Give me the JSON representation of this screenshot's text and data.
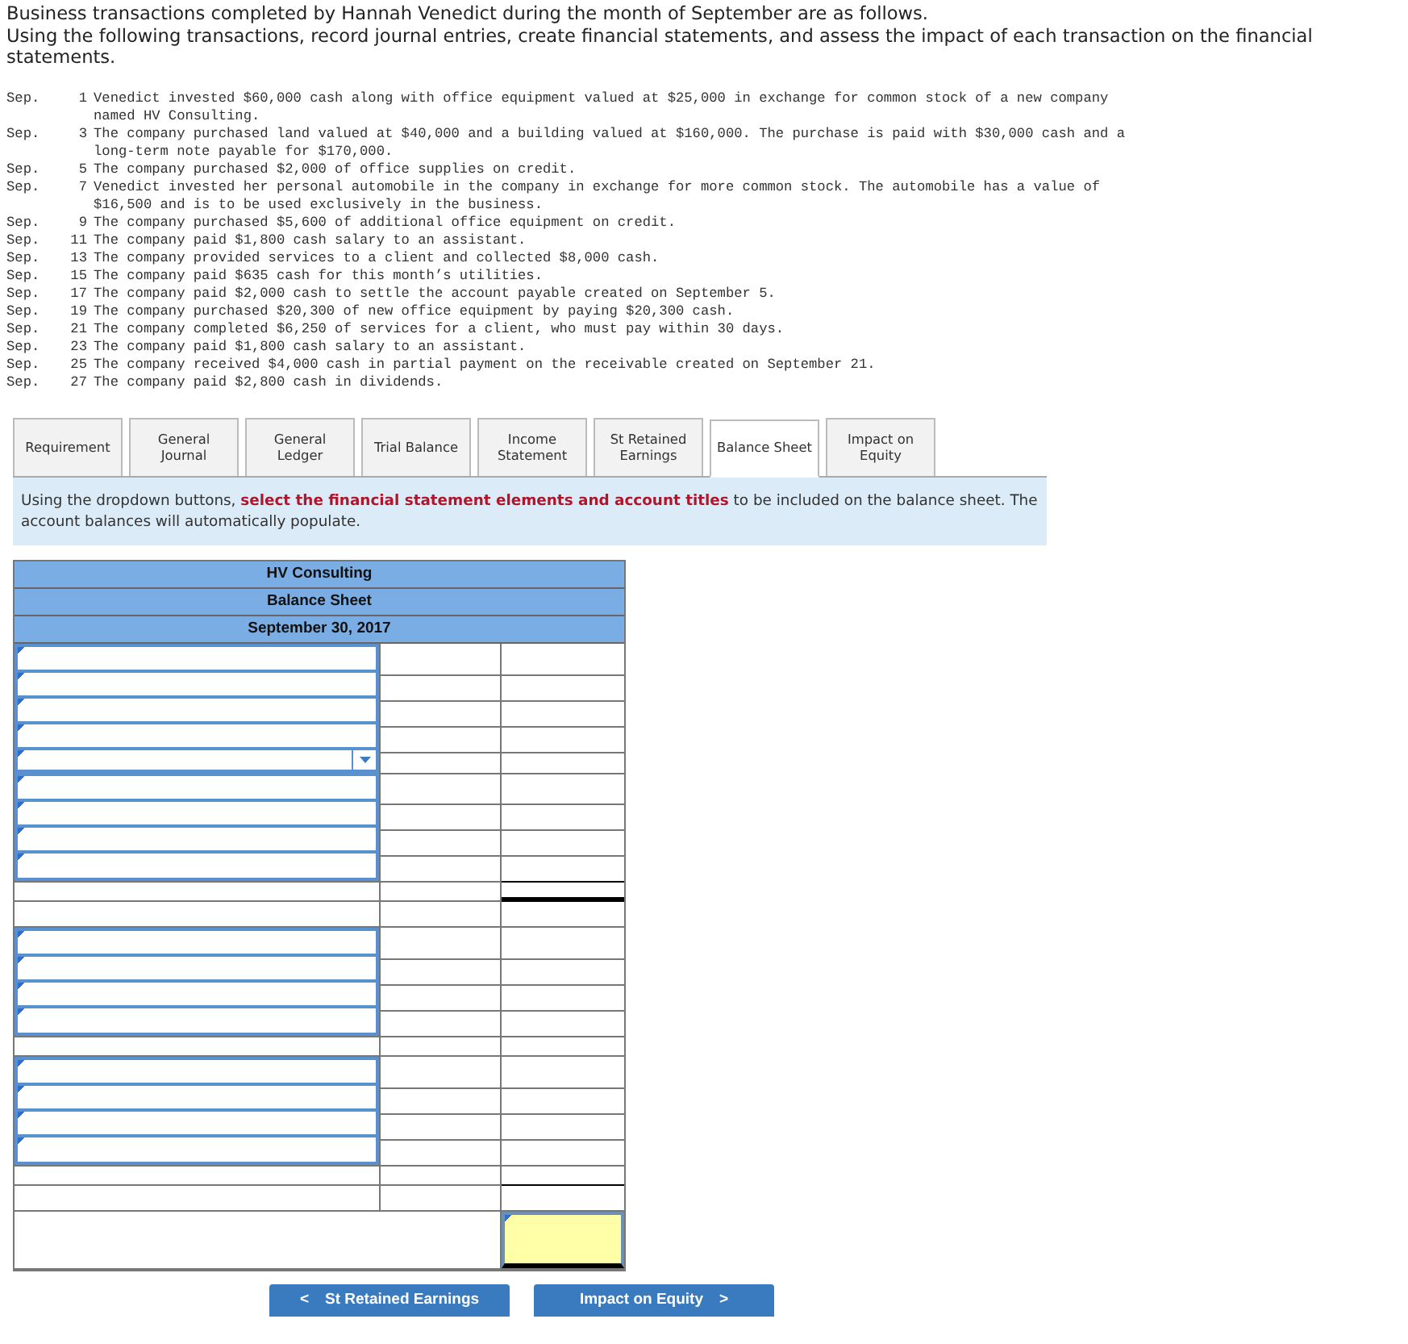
{
  "intro": [
    "Business transactions completed by Hannah Venedict during the month of September are as follows.",
    "Using the following transactions, record journal entries, create financial statements, and assess the impact of each transaction on the financial statements."
  ],
  "transactions": [
    {
      "month": "Sep.",
      "day": "1",
      "text": "Venedict invested $60,000 cash along with office equipment valued at $25,000 in exchange for common stock of a new company named HV Consulting."
    },
    {
      "month": "Sep.",
      "day": "3",
      "text": "The company purchased land valued at $40,000 and a building valued at $160,000. The purchase is paid with $30,000 cash and a long-term note payable for $170,000."
    },
    {
      "month": "Sep.",
      "day": "5",
      "text": "The company purchased $2,000 of office supplies on credit."
    },
    {
      "month": "Sep.",
      "day": "7",
      "text": "Venedict invested her personal automobile in the company in exchange for more common stock. The automobile has a value of $16,500 and is to be used exclusively in the business."
    },
    {
      "month": "Sep.",
      "day": "9",
      "text": "The company purchased $5,600 of additional office equipment on credit."
    },
    {
      "month": "Sep.",
      "day": "11",
      "text": "The company paid $1,800 cash salary to an assistant."
    },
    {
      "month": "Sep.",
      "day": "13",
      "text": "The company provided services to a client and collected $8,000 cash."
    },
    {
      "month": "Sep.",
      "day": "15",
      "text": "The company paid $635 cash for this month’s utilities."
    },
    {
      "month": "Sep.",
      "day": "17",
      "text": "The company paid $2,000 cash to settle the account payable created on September 5."
    },
    {
      "month": "Sep.",
      "day": "19",
      "text": "The company purchased $20,300 of new office equipment by paying $20,300 cash."
    },
    {
      "month": "Sep.",
      "day": "21",
      "text": "The company completed $6,250 of services for a client, who must pay within 30 days."
    },
    {
      "month": "Sep.",
      "day": "23",
      "text": "The company paid $1,800 cash salary to an assistant."
    },
    {
      "month": "Sep.",
      "day": "25",
      "text": "The company received $4,000 cash in partial payment on the receivable created on September 21."
    },
    {
      "month": "Sep.",
      "day": "27",
      "text": "The company paid $2,800 cash in dividends."
    }
  ],
  "tabs": [
    {
      "label": "Requirement",
      "selected": false
    },
    {
      "label": "General Journal",
      "selected": false
    },
    {
      "label": "General Ledger",
      "selected": false
    },
    {
      "label": "Trial Balance",
      "selected": false
    },
    {
      "label": "Income Statement",
      "selected": false
    },
    {
      "label": "St Retained Earnings",
      "selected": false
    },
    {
      "label": "Balance Sheet",
      "selected": true
    },
    {
      "label": "Impact on Equity",
      "selected": false
    }
  ],
  "instruction": "Using the dropdown buttons, **select the financial statement elements and account titles** to be included on the balance sheet. The account balances will automatically populate.",
  "statement": {
    "header": [
      "HV Consulting",
      "Balance Sheet",
      "September 30, 2017"
    ],
    "rows": [
      {
        "kind": "input"
      },
      {
        "kind": "input"
      },
      {
        "kind": "input"
      },
      {
        "kind": "input"
      },
      {
        "kind": "dropdown"
      },
      {
        "kind": "input"
      },
      {
        "kind": "input"
      },
      {
        "kind": "input"
      },
      {
        "kind": "subtotal_input"
      },
      {
        "kind": "total"
      },
      {
        "kind": "plain"
      },
      {
        "kind": "input"
      },
      {
        "kind": "input"
      },
      {
        "kind": "input"
      },
      {
        "kind": "input"
      },
      {
        "kind": "plain"
      },
      {
        "kind": "input"
      },
      {
        "kind": "input"
      },
      {
        "kind": "input"
      },
      {
        "kind": "input"
      },
      {
        "kind": "subtotal"
      },
      {
        "kind": "plain"
      },
      {
        "kind": "grand_total"
      }
    ]
  },
  "nav": [
    {
      "label": "St Retained Earnings",
      "kind": "prev",
      "symbol": "<"
    },
    {
      "label": "Impact on Equity",
      "kind": "next",
      "symbol": ">"
    }
  ]
}
